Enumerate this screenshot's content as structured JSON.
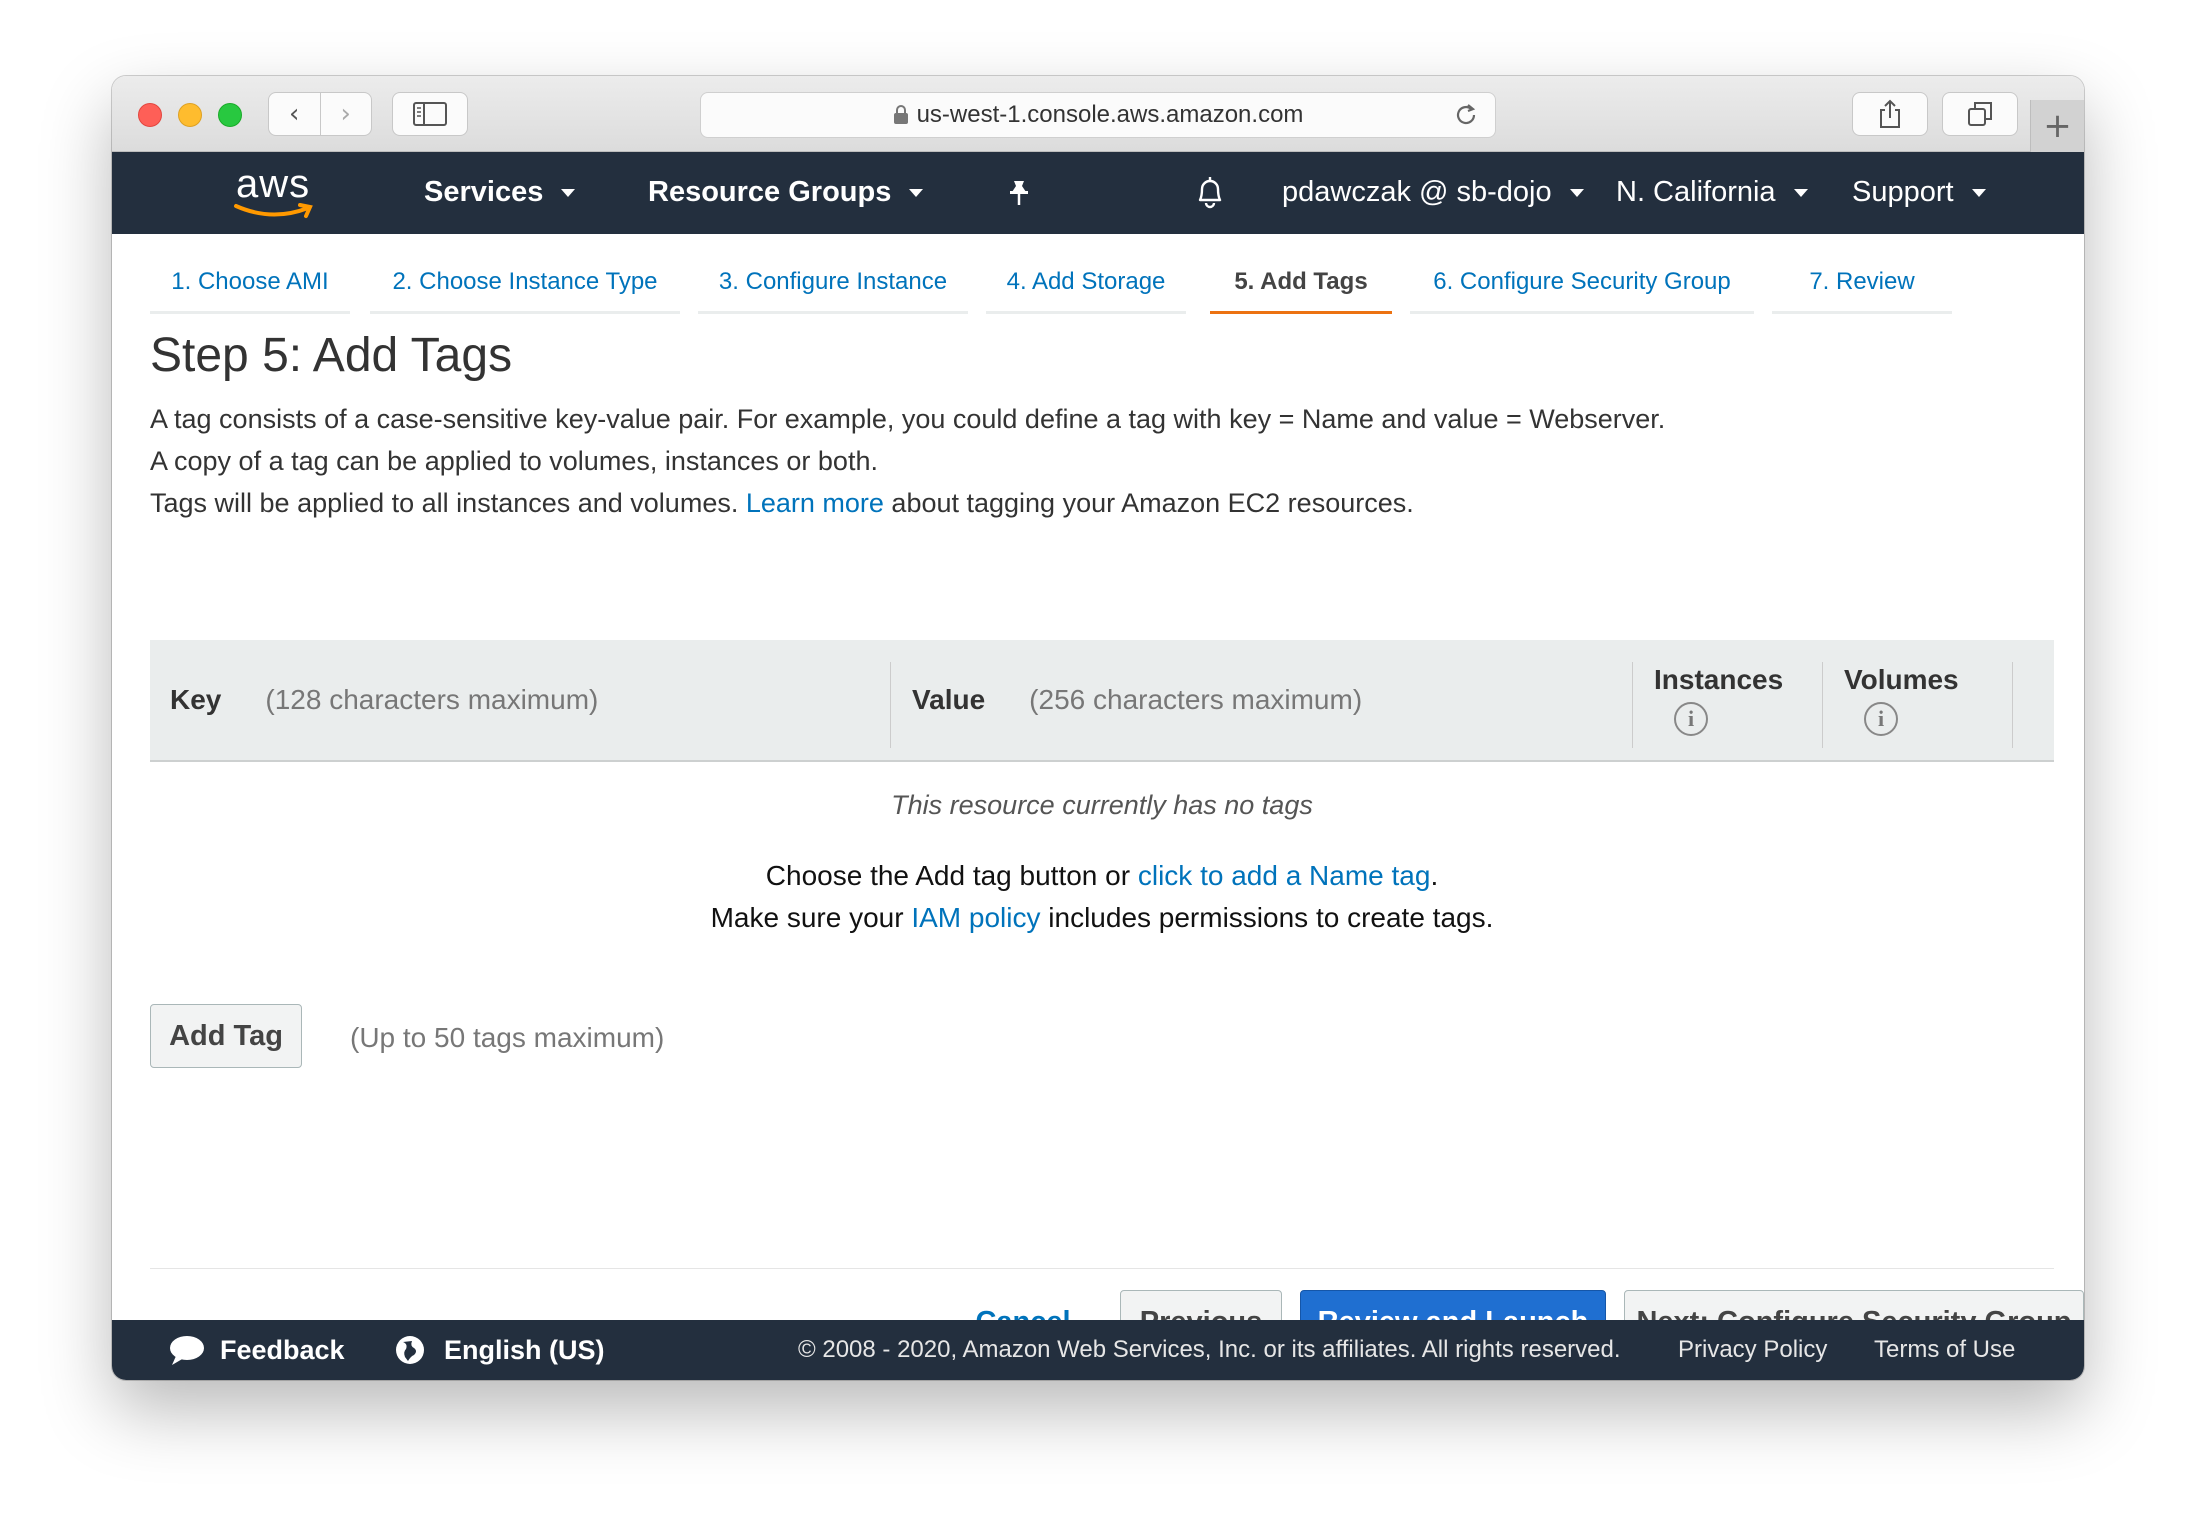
{
  "browser": {
    "url": "us-west-1.console.aws.amazon.com",
    "nav_back": "‹",
    "nav_forward": "›",
    "new_tab": "+"
  },
  "aws_nav": {
    "logo_text": "aws",
    "services": "Services",
    "resource_groups": "Resource Groups",
    "account": "pdawczak @ sb-dojo",
    "region": "N. California",
    "support": "Support"
  },
  "wizard_tabs": [
    {
      "label": "1. Choose AMI",
      "active": false
    },
    {
      "label": "2. Choose Instance Type",
      "active": false
    },
    {
      "label": "3. Configure Instance",
      "active": false
    },
    {
      "label": "4. Add Storage",
      "active": false
    },
    {
      "label": "5. Add Tags",
      "active": true
    },
    {
      "label": "6. Configure Security Group",
      "active": false
    },
    {
      "label": "7. Review",
      "active": false
    }
  ],
  "page": {
    "title": "Step 5: Add Tags",
    "desc_line1": "A tag consists of a case-sensitive key-value pair. For example, you could define a tag with key = Name and value = Webserver.",
    "desc_line2": "A copy of a tag can be applied to volumes, instances or both.",
    "desc_line3_pre": "Tags will be applied to all instances and volumes. ",
    "desc_line3_link": "Learn more",
    "desc_line3_post": " about tagging your Amazon EC2 resources."
  },
  "table": {
    "key_label": "Key",
    "key_hint": "(128 characters maximum)",
    "value_label": "Value",
    "value_hint": "(256 characters maximum)",
    "instances_label": "Instances",
    "volumes_label": "Volumes",
    "info_glyph": "i",
    "empty_message": "This resource currently has no tags",
    "help1_pre": "Choose the Add tag button or ",
    "help1_link": "click to add a Name tag",
    "help1_post": ".",
    "help2_pre": "Make sure your ",
    "help2_link": "IAM policy",
    "help2_post": " includes permissions to create tags."
  },
  "actions": {
    "add_tag": "Add Tag",
    "add_tag_hint": "(Up to 50 tags maximum)",
    "cancel": "Cancel",
    "previous": "Previous",
    "review_launch": "Review and Launch",
    "next": "Next: Configure Security Group"
  },
  "footer": {
    "feedback": "Feedback",
    "language": "English (US)",
    "copyright": "© 2008 - 2020, Amazon Web Services, Inc. or its affiliates. All rights reserved.",
    "privacy": "Privacy Policy",
    "terms": "Terms of Use"
  },
  "colors": {
    "aws_navy": "#232f3e",
    "link_blue": "#0073bb",
    "active_tab_orange": "#ec7211",
    "primary_button": "#1f6fd1"
  }
}
